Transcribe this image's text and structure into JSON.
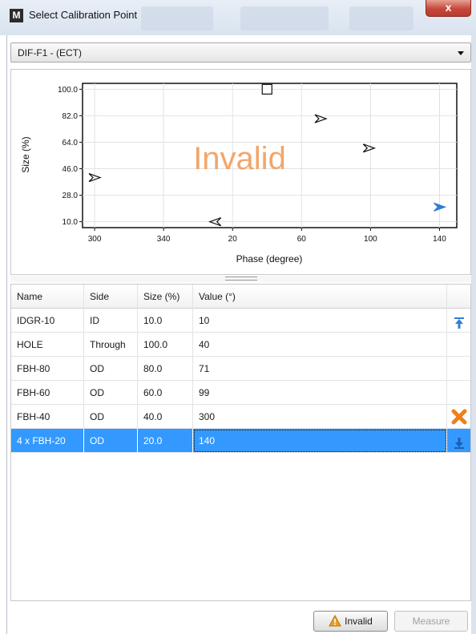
{
  "window": {
    "title": "Select Calibration Point",
    "app_icon_letter": "M",
    "close_glyph": "x"
  },
  "dropdown": {
    "selected": "DIF-F1 - (ECT)"
  },
  "chart_data": {
    "type": "scatter",
    "xlabel": "Phase (degree)",
    "ylabel": "Size (%)",
    "x_tick_labels": [
      "300",
      "340",
      "20",
      "60",
      "100",
      "140"
    ],
    "y_tick_labels": [
      "100.0",
      "82.0",
      "64.0",
      "46.0",
      "28.0",
      "10.0"
    ],
    "x_ticks_unwrapped": [
      300,
      340,
      380,
      420,
      460,
      500
    ],
    "ylim": [
      6,
      104
    ],
    "xlim_unwrapped": [
      293,
      510
    ],
    "y_ticks": [
      100,
      82,
      64,
      46,
      28,
      10
    ],
    "overlay_text": "Invalid",
    "overlay_color": "#f2a66b",
    "grid": true,
    "points": [
      {
        "name": "IDGR-10",
        "x": 10,
        "y": 10,
        "marker": "triangle-left"
      },
      {
        "name": "HOLE",
        "x": 40,
        "y": 100,
        "marker": "square"
      },
      {
        "name": "FBH-80",
        "x": 71,
        "y": 80,
        "marker": "triangle-right"
      },
      {
        "name": "FBH-60",
        "x": 99,
        "y": 60,
        "marker": "triangle-right"
      },
      {
        "name": "FBH-40",
        "x": 300,
        "y": 40,
        "marker": "triangle-right"
      },
      {
        "name": "4 x FBH-20",
        "x": 140,
        "y": 20,
        "marker": "triangle-right",
        "selected": true
      }
    ],
    "selected_color": "#2f7fd6"
  },
  "table": {
    "columns": [
      "Name",
      "Side",
      "Size (%)",
      "Value (°)"
    ],
    "rows": [
      {
        "name": "IDGR-10",
        "side": "ID",
        "size": "10.0",
        "value": "10",
        "action_icon": "move-to-top-icon"
      },
      {
        "name": "HOLE",
        "side": "Through",
        "size": "100.0",
        "value": "40",
        "action_icon": ""
      },
      {
        "name": "FBH-80",
        "side": "OD",
        "size": "80.0",
        "value": "71",
        "action_icon": ""
      },
      {
        "name": "FBH-60",
        "side": "OD",
        "size": "60.0",
        "value": "99",
        "action_icon": ""
      },
      {
        "name": "FBH-40",
        "side": "OD",
        "size": "40.0",
        "value": "300",
        "action_icon": "delete-icon"
      },
      {
        "name": "4 x FBH-20",
        "side": "OD",
        "size": "20.0",
        "value": "140",
        "action_icon": "move-to-bottom-icon",
        "selected": true
      }
    ]
  },
  "footer": {
    "invalid_label": "Invalid",
    "measure_label": "Measure"
  },
  "colors": {
    "selection": "#3399ff",
    "accent_blue": "#2f7fd6",
    "delete_orange": "#f07f1a",
    "warning_orange": "#e8a020",
    "close_red": "#c7483b"
  }
}
